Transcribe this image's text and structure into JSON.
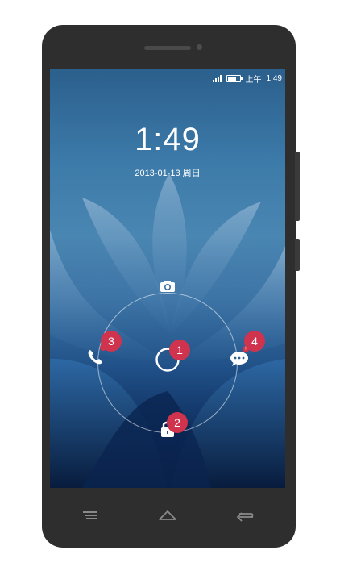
{
  "status_bar": {
    "ampm": "上午",
    "time": "1:49"
  },
  "lock_screen": {
    "clock": "1:49",
    "date": "2013-01-13 周日"
  },
  "unlock": {
    "badges": {
      "center": "1",
      "bottom": "2",
      "left": "3",
      "right": "4"
    },
    "mini_badge_mark": "!"
  },
  "icons": {
    "top": "camera-icon",
    "left": "phone-icon",
    "right": "message-icon",
    "bottom": "unlock-icon",
    "center": "ring-handle-icon",
    "nav": [
      "menu-icon",
      "home-icon",
      "back-icon"
    ]
  },
  "colors": {
    "badge": "#d0334d",
    "phone_body": "#2e2e2e"
  }
}
